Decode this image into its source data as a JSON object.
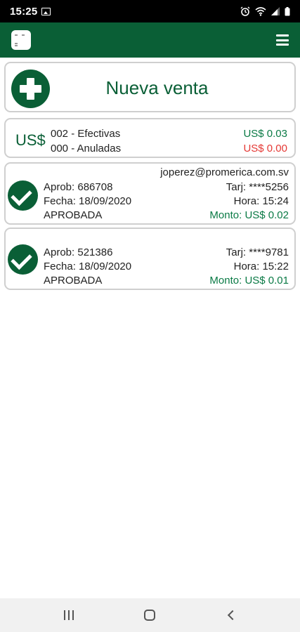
{
  "status_bar": {
    "time": "15:25",
    "icons": [
      "image-icon",
      "alarm-icon",
      "wifi-icon",
      "signal-icon",
      "battery-icon"
    ]
  },
  "app_bar": {
    "icons": [
      "app-logo-icon",
      "hamburger-menu-icon"
    ]
  },
  "new_sale": {
    "label": "Nueva venta"
  },
  "summary": {
    "currency": "US$",
    "effective_label": "002 - Efectivas",
    "effective_amount": "US$ 0.03",
    "cancelled_label": "000 - Anuladas",
    "cancelled_amount": "US$ 0.00"
  },
  "user_email": "joperez@promerica.com.sv",
  "transactions": [
    {
      "aprob": "Aprob: 686708",
      "fecha": "Fecha: 18/09/2020",
      "estado": "APROBADA",
      "tarj": "Tarj: ****5256",
      "hora": "Hora: 15:24",
      "monto": "Monto: US$ 0.02"
    },
    {
      "aprob": "Aprob: 521386",
      "fecha": "Fecha: 18/09/2020",
      "estado": "APROBADA",
      "tarj": "Tarj: ****9781",
      "hora": "Hora: 15:22",
      "monto": "Monto: US$ 0.01"
    }
  ],
  "colors": {
    "brand_green": "#0a5f36",
    "positive": "#0a7a45",
    "negative": "#e53935"
  }
}
